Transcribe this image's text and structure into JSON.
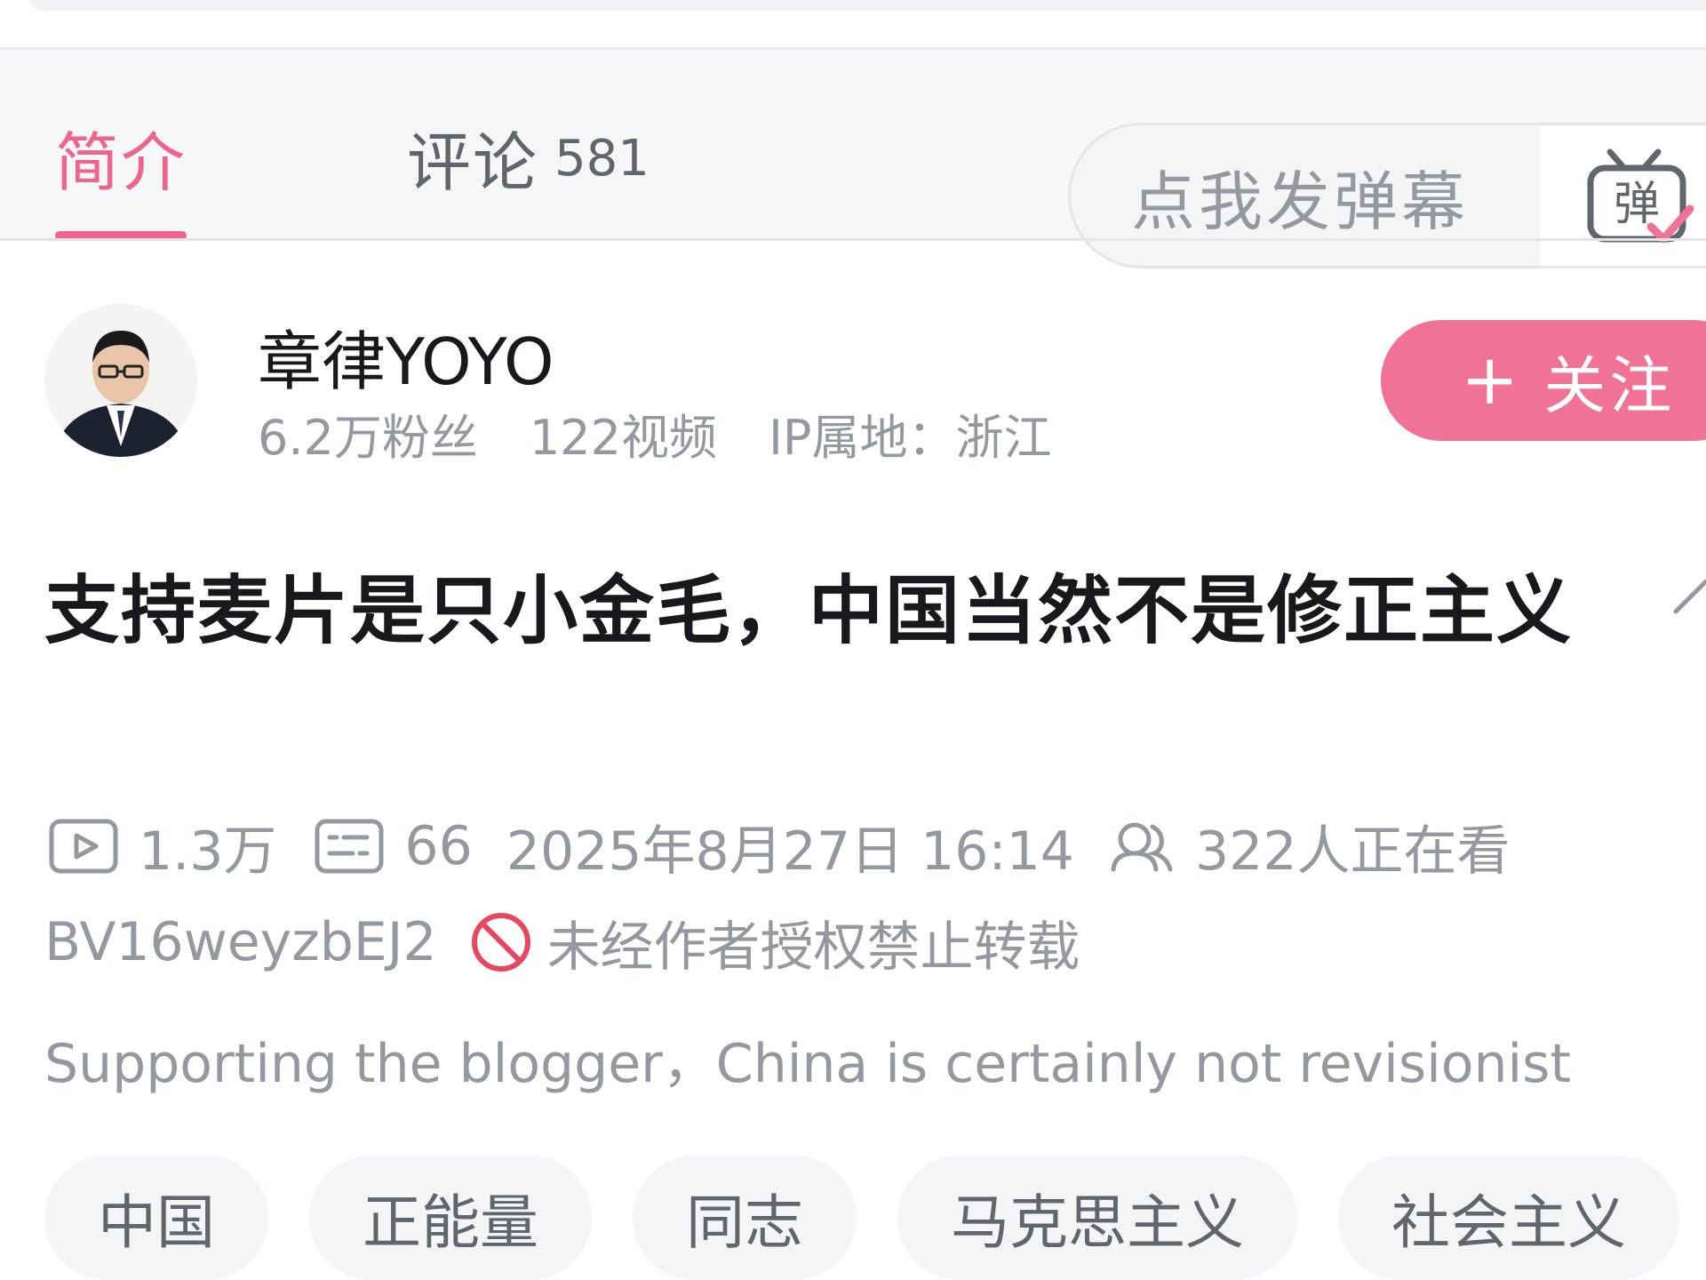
{
  "tabs": {
    "intro_label": "简介",
    "comments_label": "评论",
    "comments_count": "581"
  },
  "danmaku": {
    "placeholder": "点我发弹幕",
    "toggle_glyph": "弹"
  },
  "uploader": {
    "name": "章律YOYO",
    "followers": "6.2万粉丝",
    "videos": "122视频",
    "ip_location": "IP属地：浙江",
    "follow_plus": "+",
    "follow_label": "关注"
  },
  "video": {
    "title": "支持麦片是只小金毛，中国当然不是修正主义",
    "play_count": "1.3万",
    "danmaku_count": "66",
    "publish_time": "2025年8月27日 16:14",
    "watching_now": "322人正在看",
    "bvid": "BV16weyzbEJ2",
    "copyright_notice": "未经作者授权禁止转载",
    "description": "Supporting the blogger，China is certainly not revisionist"
  },
  "tags": [
    "中国",
    "正能量",
    "同志",
    "马克思主义",
    "社会主义"
  ],
  "colors": {
    "accent": "#f0648c",
    "follow_bg": "#f07397",
    "muted_text": "#9499a0",
    "tab_text": "#61666d",
    "ban_red": "#e8485f"
  }
}
